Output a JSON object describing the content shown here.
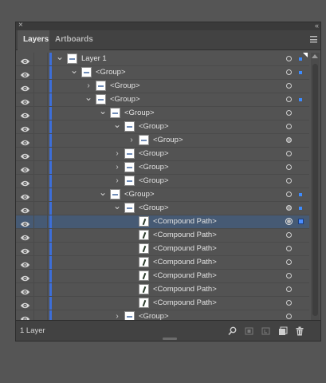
{
  "panel": {
    "tabs": [
      {
        "label": "Layers",
        "active": true
      },
      {
        "label": "Artboards",
        "active": false
      }
    ],
    "footer_count": "1 Layer",
    "colors": {
      "layer_color": "#3d6ed8",
      "selection_bg": "#465a74",
      "selected_square": "#4b8dff"
    }
  },
  "rows": [
    {
      "name": "Layer 1",
      "indent": 0,
      "expander": "down",
      "target": "hollow",
      "selected_square": "small",
      "corner": true
    },
    {
      "name": "<Group>",
      "indent": 1,
      "expander": "down",
      "target": "hollow",
      "selected_square": "small"
    },
    {
      "name": "<Group>",
      "indent": 2,
      "expander": "right",
      "target": "hollow",
      "selected_square": "none"
    },
    {
      "name": "<Group>",
      "indent": 2,
      "expander": "down",
      "target": "hollow",
      "selected_square": "small"
    },
    {
      "name": "<Group>",
      "indent": 3,
      "expander": "down",
      "target": "hollow",
      "selected_square": "none"
    },
    {
      "name": "<Group>",
      "indent": 4,
      "expander": "down",
      "target": "hollow",
      "selected_square": "none"
    },
    {
      "name": "<Group>",
      "indent": 5,
      "expander": "right",
      "target": "filled",
      "selected_square": "none"
    },
    {
      "name": "<Group>",
      "indent": 4,
      "expander": "right",
      "target": "hollow",
      "selected_square": "none"
    },
    {
      "name": "<Group>",
      "indent": 4,
      "expander": "right",
      "target": "hollow",
      "selected_square": "none"
    },
    {
      "name": "<Group>",
      "indent": 4,
      "expander": "right",
      "target": "hollow",
      "selected_square": "none"
    },
    {
      "name": "<Group>",
      "indent": 3,
      "expander": "down",
      "target": "hollow",
      "selected_square": "small"
    },
    {
      "name": "<Group>",
      "indent": 4,
      "expander": "down",
      "target": "filled",
      "selected_square": "small"
    },
    {
      "name": "<Compound Path>",
      "indent": 5,
      "expander": "none",
      "target": "selected",
      "selected_square": "big",
      "selected": true
    },
    {
      "name": "<Compound Path>",
      "indent": 5,
      "expander": "none",
      "target": "hollow",
      "selected_square": "none"
    },
    {
      "name": "<Compound Path>",
      "indent": 5,
      "expander": "none",
      "target": "hollow",
      "selected_square": "none"
    },
    {
      "name": "<Compound Path>",
      "indent": 5,
      "expander": "none",
      "target": "hollow",
      "selected_square": "none"
    },
    {
      "name": "<Compound Path>",
      "indent": 5,
      "expander": "none",
      "target": "hollow",
      "selected_square": "none"
    },
    {
      "name": "<Compound Path>",
      "indent": 5,
      "expander": "none",
      "target": "hollow",
      "selected_square": "none"
    },
    {
      "name": "<Compound Path>",
      "indent": 5,
      "expander": "none",
      "target": "hollow",
      "selected_square": "none"
    },
    {
      "name": "<Group>",
      "indent": 4,
      "expander": "right",
      "target": "hollow",
      "selected_square": "none"
    }
  ],
  "footer_icons": [
    "locate-object-icon",
    "make-clipping-mask-icon",
    "create-sublayer-icon",
    "create-new-layer-icon",
    "delete-icon"
  ]
}
